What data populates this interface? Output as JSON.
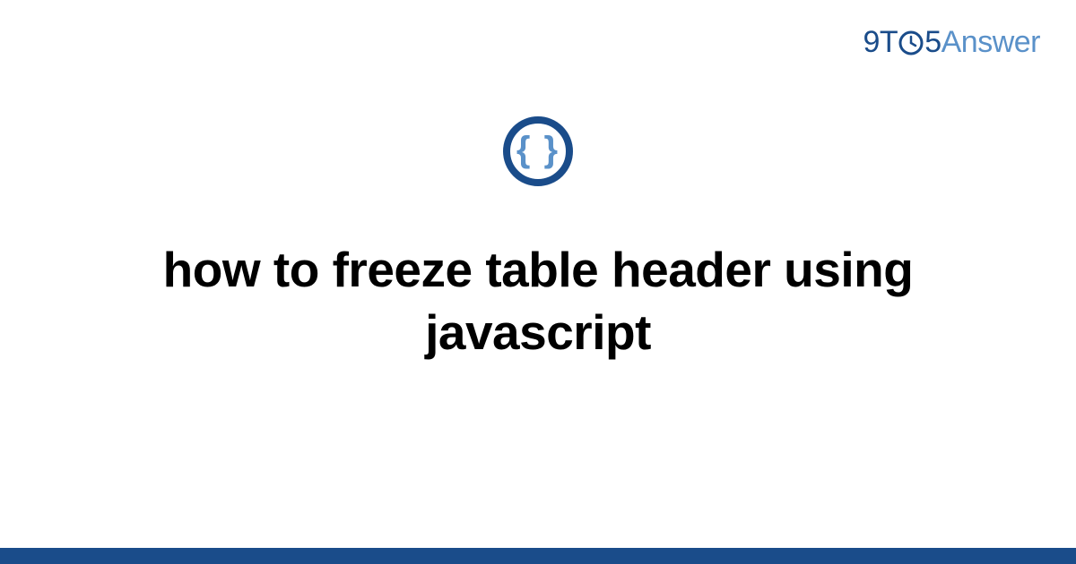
{
  "logo": {
    "part1": "9T",
    "part2": "5",
    "answer": "Answer",
    "icon_name": "clock-o-icon"
  },
  "center_icon": {
    "name": "code-braces-icon",
    "glyph": "{ }"
  },
  "title": "how to freeze table header using javascript",
  "colors": {
    "brand_dark": "#1a4c8a",
    "brand_light": "#5a91c9",
    "text": "#000000",
    "bg": "#ffffff"
  }
}
